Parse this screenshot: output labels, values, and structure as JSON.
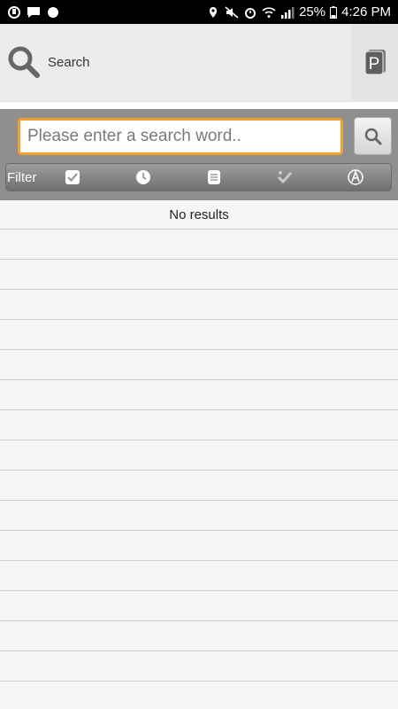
{
  "status_bar": {
    "left_icons": [
      "app-icon",
      "chat-icon",
      "bean-icon"
    ],
    "right_icons": [
      "location-icon",
      "mute-icon",
      "alarm-icon",
      "wifi-icon",
      "signal-icon"
    ],
    "battery": "25%",
    "time": "4:26 PM"
  },
  "header": {
    "title": "Search",
    "search_icon": "search-icon",
    "right_icon": "p-icon"
  },
  "search": {
    "placeholder": "Please enter a search word..",
    "value": "",
    "button_icon": "search-icon"
  },
  "filter": {
    "label": "Filter",
    "buttons": [
      {
        "name": "checkbox-icon"
      },
      {
        "name": "clock-icon"
      },
      {
        "name": "document-icon"
      },
      {
        "name": "checkmark-icon"
      },
      {
        "name": "circle-a-icon"
      }
    ]
  },
  "results": {
    "message": "No results",
    "empty_rows": 16
  },
  "colors": {
    "accent": "#f0a030",
    "search_bar_bg": "#8f8f8f",
    "header_bg": "#ececec"
  }
}
